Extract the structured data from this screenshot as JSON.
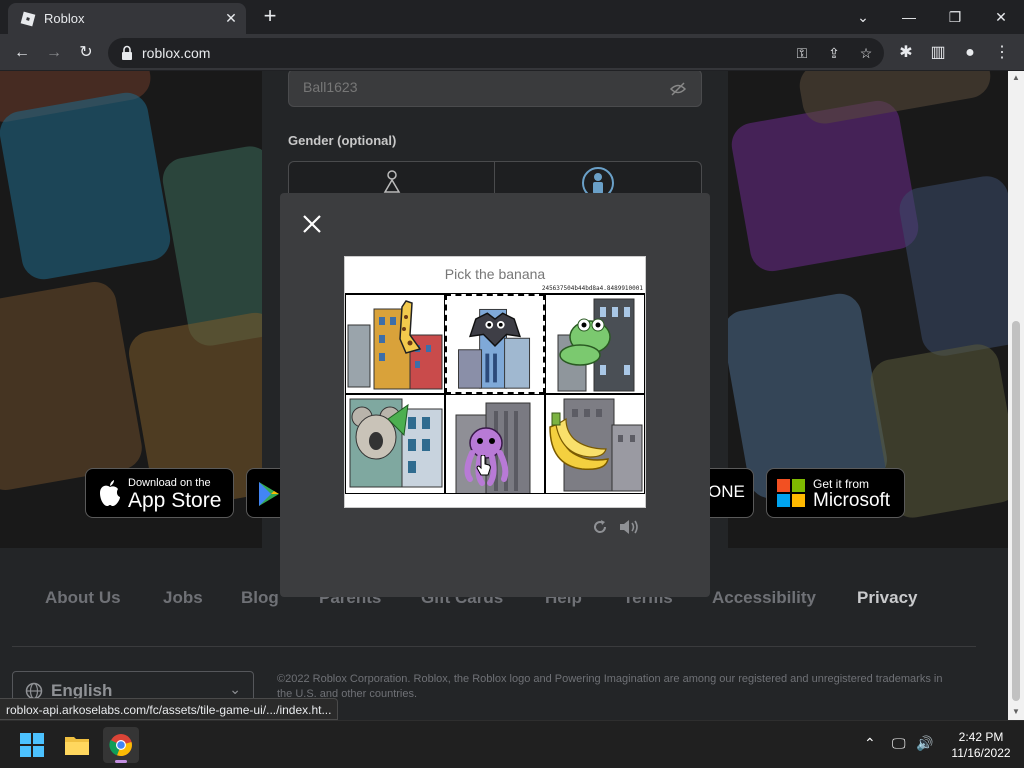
{
  "browser": {
    "tab_title": "Roblox",
    "url": "roblox.com",
    "status_url": "roblox-api.arkoselabs.com/fc/assets/tile-game-ui/.../index.ht..."
  },
  "signup": {
    "password_placeholder": "Ball1623",
    "gender_label": "Gender (optional)"
  },
  "app_badges": {
    "appstore_small": "Download on the",
    "appstore_big": "App Store",
    "xbox_text": "ONE",
    "microsoft_small": "Get it from",
    "microsoft_big": "Microsoft"
  },
  "footer": {
    "links": [
      "About Us",
      "Jobs",
      "Blog",
      "Parents",
      "Gift Cards",
      "Help",
      "Terms",
      "Accessibility",
      "Privacy"
    ],
    "language": "English",
    "copyright": "©2022 Roblox Corporation. Roblox, the Roblox logo and Powering Imagination are among our registered and unregistered trademarks in the U.S. and other countries."
  },
  "captcha": {
    "prompt": "Pick the banana",
    "challenge_id": "245637504b44bd8a4.8489910001",
    "tiles": [
      {
        "subject": "giraffe"
      },
      {
        "subject": "bat"
      },
      {
        "subject": "frog"
      },
      {
        "subject": "koala"
      },
      {
        "subject": "octopus"
      },
      {
        "subject": "banana"
      }
    ],
    "selected_tile": 1
  },
  "taskbar": {
    "time": "2:42 PM",
    "date": "11/16/2022"
  },
  "colors": {
    "modal_bg": "#3c3d3f",
    "page_bg": "#191919",
    "footer_bg": "#232527"
  }
}
